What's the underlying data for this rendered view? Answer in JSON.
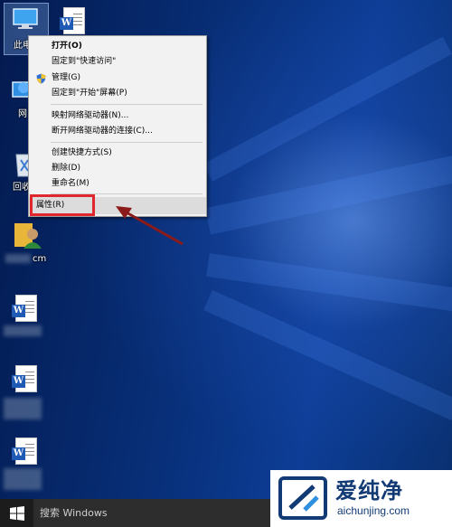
{
  "desktop": {
    "icons": [
      {
        "label": "此电"
      },
      {
        "label": "网"
      },
      {
        "label": "回收"
      },
      {
        "label": "cm"
      }
    ]
  },
  "context_menu": {
    "items": [
      {
        "label": "打开(O)",
        "group": 1
      },
      {
        "label": "固定到\"快速访问\"",
        "group": 1
      },
      {
        "label": "管理(G)",
        "group": 1,
        "icon": "shield-icon"
      },
      {
        "label": "固定到\"开始\"屏幕(P)",
        "group": 1
      },
      {
        "label": "映射网络驱动器(N)...",
        "group": 2
      },
      {
        "label": "断开网络驱动器的连接(C)...",
        "group": 2
      },
      {
        "label": "创建快捷方式(S)",
        "group": 3
      },
      {
        "label": "删除(D)",
        "group": 3
      },
      {
        "label": "重命名(M)",
        "group": 3
      },
      {
        "label": "属性(R)",
        "group": 4,
        "highlighted": true
      }
    ]
  },
  "taskbar": {
    "search_placeholder": "搜索 Windows"
  },
  "watermark": {
    "title": "爱纯净",
    "url": "aichunjing.com"
  },
  "colors": {
    "highlight_border": "#e0262e",
    "arrow": "#8b1a1a",
    "watermark_text": "#123a74"
  }
}
